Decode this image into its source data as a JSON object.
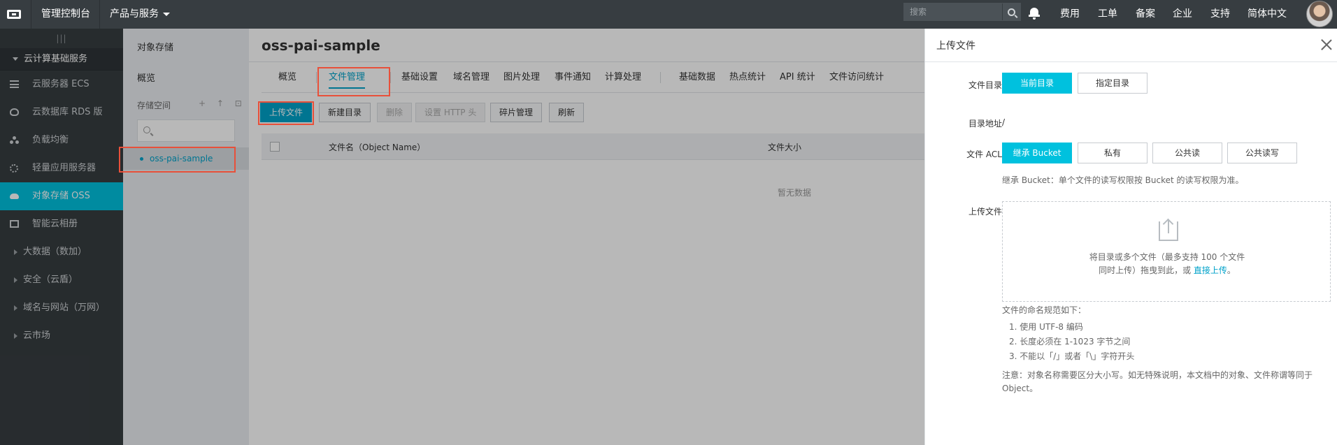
{
  "topbar": {
    "console_label": "管理控制台",
    "products_label": "产品与服务",
    "search_placeholder": "搜索",
    "links": [
      "费用",
      "工单",
      "备案",
      "企业",
      "支持",
      "简体中文"
    ]
  },
  "sidebar": {
    "grip": "|||",
    "group_label": "云计算基础服务",
    "items": [
      {
        "label": "云服务器 ECS",
        "icon": "server-icon"
      },
      {
        "label": "云数据库 RDS 版",
        "icon": "database-icon"
      },
      {
        "label": "负载均衡",
        "icon": "load-balancer-icon"
      },
      {
        "label": "轻量应用服务器",
        "icon": "gear-icon"
      },
      {
        "label": "对象存储 OSS",
        "icon": "cloud-icon"
      },
      {
        "label": "智能云相册",
        "icon": "photo-album-icon"
      }
    ],
    "subgroups": [
      "大数据（数加）",
      "安全（云盾）",
      "域名与网站（万网）",
      "云市场"
    ]
  },
  "oss_nav": {
    "title": "对象存储",
    "overview": "概览",
    "bucket_section": "存储空间",
    "tools": "+ ↑ ⊡",
    "bucket_name": "oss-pai-sample"
  },
  "main": {
    "bucket_title": "oss-pai-sample",
    "tabs": [
      "概览",
      "文件管理",
      "基础设置",
      "域名管理",
      "图片处理",
      "事件通知",
      "计算处理",
      "基础数据",
      "热点统计",
      "API 统计",
      "文件访问统计"
    ],
    "active_tab": "文件管理",
    "buttons": {
      "upload": "上传文件",
      "new_dir": "新建目录",
      "delete": "删除",
      "http_header": "设置 HTTP 头",
      "fragments": "碎片管理",
      "refresh": "刷新"
    },
    "columns": [
      "文件名（Object Name）",
      "文件大小"
    ],
    "empty_text": "暂无数据"
  },
  "drawer": {
    "title": "上传文件",
    "dir_label": "文件目录",
    "dir_options": [
      "当前目录",
      "指定目录"
    ],
    "addr_label": "目录地址",
    "addr_value": "/",
    "acl_label": "文件 ACL",
    "acl_options": [
      "继承 Bucket",
      "私有",
      "公共读",
      "公共读写"
    ],
    "acl_hint": "继承 Bucket：单个文件的读写权限按 Bucket 的读写权限为准。",
    "upload_label": "上传文件",
    "dropzone_line1": "将目录或多个文件（最多支持 100 个文件",
    "dropzone_line2": "同时上传）拖曳到此，或",
    "dropzone_link": "直接上传",
    "dropzone_end": "。",
    "rules_title": "文件的命名规范如下：",
    "rules": [
      "1. 使用 UTF-8 编码",
      "2. 长度必须在 1-1023 字节之间",
      "3. 不能以「/」或者「\\」字符开头"
    ],
    "note_line1": "注意：对象名称需要区分大小写。如无特殊说明，本文档中的对象、文件称谓等同于",
    "note_line2": "Object。"
  },
  "colors": {
    "topbar_bg": "#373d41",
    "accent": "#00c1de",
    "link": "#00a2ca",
    "highlight": "#e8503a"
  }
}
